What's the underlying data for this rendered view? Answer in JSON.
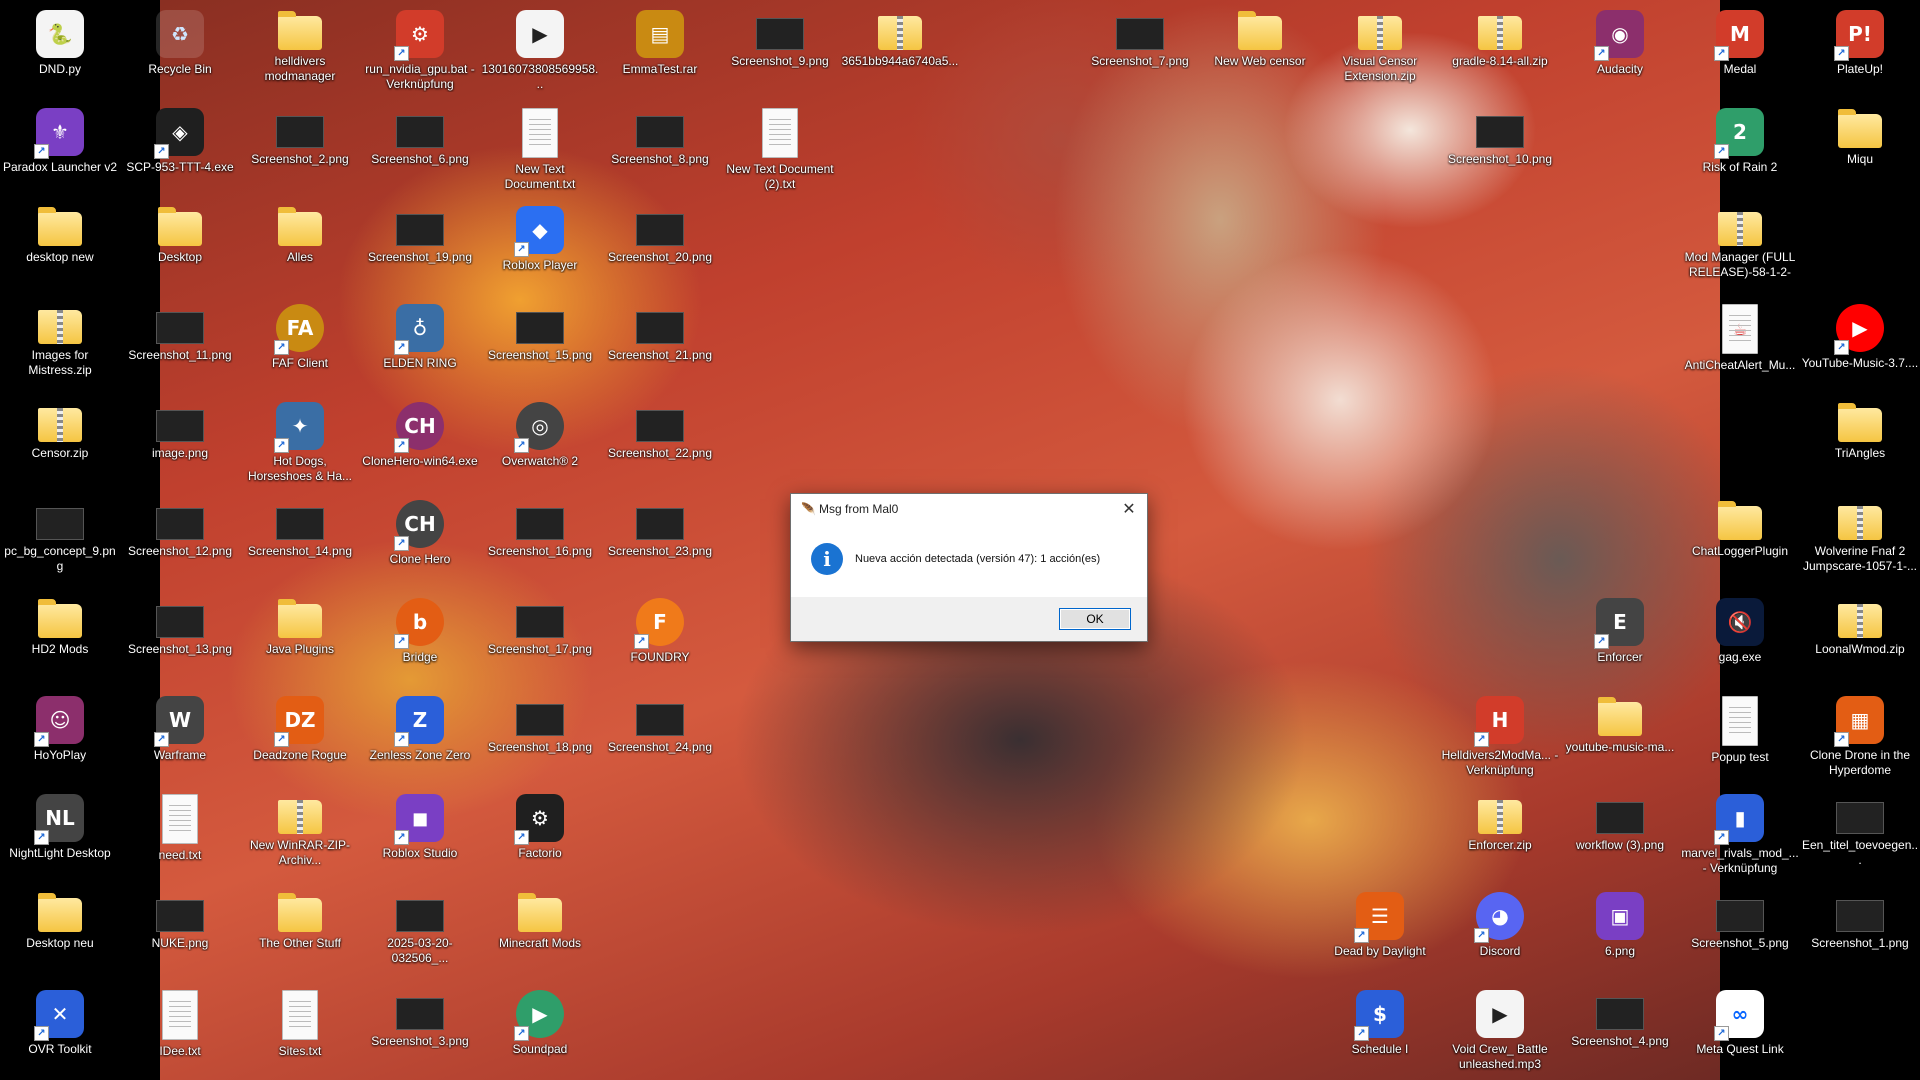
{
  "desktop": {
    "icons": [
      {
        "label": "DND.py",
        "kind": "python",
        "icon": "python-file-icon",
        "col": 0,
        "row": 0
      },
      {
        "label": "Paradox Launcher v2",
        "kind": "app",
        "icon": "paradox-launcher-icon",
        "col": 0,
        "row": 1
      },
      {
        "label": "desktop new",
        "kind": "folder",
        "icon": "folder-icon",
        "col": 0,
        "row": 2
      },
      {
        "label": "Images for Mistress.zip",
        "kind": "zip",
        "icon": "zip-folder-icon",
        "col": 0,
        "row": 3
      },
      {
        "label": "Censor.zip",
        "kind": "zip",
        "icon": "zip-folder-icon",
        "col": 0,
        "row": 4
      },
      {
        "label": "pc_bg_concept_9.png",
        "kind": "shot",
        "icon": "image-file-icon",
        "col": 0,
        "row": 5
      },
      {
        "label": "HD2 Mods",
        "kind": "folder",
        "icon": "folder-icon",
        "col": 0,
        "row": 6
      },
      {
        "label": "HoYoPlay",
        "kind": "app",
        "icon": "hoyoplay-icon",
        "col": 0,
        "row": 7
      },
      {
        "label": "NightLight Desktop",
        "kind": "app",
        "icon": "nightlight-icon",
        "col": 0,
        "row": 8
      },
      {
        "label": "Desktop neu",
        "kind": "folder",
        "icon": "folder-icon",
        "col": 0,
        "row": 9
      },
      {
        "label": "OVR Toolkit",
        "kind": "app",
        "icon": "ovr-toolkit-icon",
        "col": 0,
        "row": 10
      },
      {
        "label": "Recycle Bin",
        "kind": "bin",
        "icon": "recycle-bin-icon",
        "col": 1,
        "row": 0
      },
      {
        "label": "SCP-953-TTT-4.exe",
        "kind": "app",
        "icon": "exe-icon",
        "col": 1,
        "row": 1
      },
      {
        "label": "Desktop",
        "kind": "folder",
        "icon": "folder-icon",
        "col": 1,
        "row": 2
      },
      {
        "label": "Screenshot_11.png",
        "kind": "shot",
        "icon": "image-file-icon",
        "col": 1,
        "row": 3
      },
      {
        "label": "image.png",
        "kind": "shot",
        "icon": "image-file-icon",
        "col": 1,
        "row": 4
      },
      {
        "label": "Screenshot_12.png",
        "kind": "shot",
        "icon": "image-file-icon",
        "col": 1,
        "row": 5
      },
      {
        "label": "Screenshot_13.png",
        "kind": "shot",
        "icon": "image-file-icon",
        "col": 1,
        "row": 6
      },
      {
        "label": "Warframe",
        "kind": "app",
        "icon": "warframe-icon",
        "col": 1,
        "row": 7
      },
      {
        "label": "need.txt",
        "kind": "doc",
        "icon": "text-file-icon",
        "col": 1,
        "row": 8
      },
      {
        "label": "NUKE.png",
        "kind": "shot",
        "icon": "image-file-icon",
        "col": 1,
        "row": 9
      },
      {
        "label": "IDee.txt",
        "kind": "doc",
        "icon": "text-file-icon",
        "col": 1,
        "row": 10
      },
      {
        "label": "helldivers modmanager",
        "kind": "folder",
        "icon": "folder-icon",
        "col": 2,
        "row": 0
      },
      {
        "label": "Screenshot_2.png",
        "kind": "shot",
        "icon": "image-file-icon",
        "col": 2,
        "row": 1
      },
      {
        "label": "Alles",
        "kind": "folder",
        "icon": "folder-icon",
        "col": 2,
        "row": 2
      },
      {
        "label": "FAF Client",
        "kind": "app",
        "icon": "faf-client-icon",
        "col": 2,
        "row": 3
      },
      {
        "label": "Hot Dogs, Horseshoes & Ha...",
        "kind": "app",
        "icon": "hot-dogs-icon",
        "col": 2,
        "row": 4
      },
      {
        "label": "Screenshot_14.png",
        "kind": "shot",
        "icon": "image-file-icon",
        "col": 2,
        "row": 5
      },
      {
        "label": "Java Plugins",
        "kind": "folder",
        "icon": "folder-icon",
        "col": 2,
        "row": 6
      },
      {
        "label": "Deadzone Rogue",
        "kind": "app",
        "icon": "deadzone-rogue-icon",
        "col": 2,
        "row": 7
      },
      {
        "label": "New WinRAR-ZIP-Archiv...",
        "kind": "zip",
        "icon": "zip-folder-icon",
        "col": 2,
        "row": 8
      },
      {
        "label": "The Other Stuff",
        "kind": "folder",
        "icon": "folder-icon",
        "col": 2,
        "row": 9
      },
      {
        "label": "Sites.txt",
        "kind": "doc",
        "icon": "text-file-icon",
        "col": 2,
        "row": 10
      },
      {
        "label": "run_nvidia_gpu.bat - Verknüpfung",
        "kind": "bat",
        "icon": "batch-file-icon",
        "col": 3,
        "row": 0
      },
      {
        "label": "Screenshot_6.png",
        "kind": "shot",
        "icon": "image-file-icon",
        "col": 3,
        "row": 1
      },
      {
        "label": "Screenshot_19.png",
        "kind": "shot",
        "icon": "image-file-icon",
        "col": 3,
        "row": 2
      },
      {
        "label": "ELDEN RING",
        "kind": "app",
        "icon": "elden-ring-icon",
        "col": 3,
        "row": 3
      },
      {
        "label": "CloneHero-win64.exe",
        "kind": "app",
        "icon": "clone-hero-installer-icon",
        "col": 3,
        "row": 4
      },
      {
        "label": "Clone Hero",
        "kind": "app",
        "icon": "clone-hero-icon",
        "col": 3,
        "row": 5
      },
      {
        "label": "Bridge",
        "kind": "app",
        "icon": "bridge-icon",
        "col": 3,
        "row": 6
      },
      {
        "label": "Zenless Zone Zero",
        "kind": "app",
        "icon": "zenless-zone-zero-icon",
        "col": 3,
        "row": 7
      },
      {
        "label": "Roblox Studio",
        "kind": "app",
        "icon": "roblox-studio-icon",
        "col": 3,
        "row": 8
      },
      {
        "label": "2025-03-20-032506_...",
        "kind": "shot",
        "icon": "image-file-icon",
        "col": 3,
        "row": 9
      },
      {
        "label": "Screenshot_3.png",
        "kind": "shot",
        "icon": "image-file-icon",
        "col": 3,
        "row": 10
      },
      {
        "label": "13016073808569958...",
        "kind": "media",
        "icon": "media-file-icon",
        "col": 4,
        "row": 0
      },
      {
        "label": "New Text Document.txt",
        "kind": "doc",
        "icon": "text-file-icon",
        "col": 4,
        "row": 1
      },
      {
        "label": "Roblox Player",
        "kind": "app",
        "icon": "roblox-player-icon",
        "col": 4,
        "row": 2
      },
      {
        "label": "Screenshot_15.png",
        "kind": "shot",
        "icon": "image-file-icon",
        "col": 4,
        "row": 3
      },
      {
        "label": "Overwatch® 2",
        "kind": "app",
        "icon": "overwatch-icon",
        "col": 4,
        "row": 4
      },
      {
        "label": "Screenshot_16.png",
        "kind": "shot",
        "icon": "image-file-icon",
        "col": 4,
        "row": 5
      },
      {
        "label": "Screenshot_17.png",
        "kind": "shot",
        "icon": "image-file-icon",
        "col": 4,
        "row": 6
      },
      {
        "label": "Screenshot_18.png",
        "kind": "shot",
        "icon": "image-file-icon",
        "col": 4,
        "row": 7
      },
      {
        "label": "Factorio",
        "kind": "app",
        "icon": "factorio-icon",
        "col": 4,
        "row": 8
      },
      {
        "label": "Minecraft Mods",
        "kind": "folder",
        "icon": "folder-icon",
        "col": 4,
        "row": 9
      },
      {
        "label": "Soundpad",
        "kind": "app",
        "icon": "soundpad-icon",
        "col": 4,
        "row": 10
      },
      {
        "label": "EmmaTest.rar",
        "kind": "rar",
        "icon": "winrar-archive-icon",
        "col": 5,
        "row": 0
      },
      {
        "label": "Screenshot_8.png",
        "kind": "shot",
        "icon": "image-file-icon",
        "col": 5,
        "row": 1
      },
      {
        "label": "Screenshot_20.png",
        "kind": "shot",
        "icon": "image-file-icon",
        "col": 5,
        "row": 2
      },
      {
        "label": "Screenshot_21.png",
        "kind": "shot",
        "icon": "image-file-icon",
        "col": 5,
        "row": 3
      },
      {
        "label": "Screenshot_22.png",
        "kind": "shot",
        "icon": "image-file-icon",
        "col": 5,
        "row": 4
      },
      {
        "label": "Screenshot_23.png",
        "kind": "shot",
        "icon": "image-file-icon",
        "col": 5,
        "row": 5
      },
      {
        "label": "FOUNDRY",
        "kind": "app",
        "icon": "foundry-icon",
        "col": 5,
        "row": 6
      },
      {
        "label": "Screenshot_24.png",
        "kind": "shot",
        "icon": "image-file-icon",
        "col": 5,
        "row": 7
      },
      {
        "label": "Screenshot_9.png",
        "kind": "shot",
        "icon": "image-file-icon",
        "col": 6,
        "row": 0
      },
      {
        "label": "New Text Document (2).txt",
        "kind": "doc",
        "icon": "text-file-icon",
        "col": 6,
        "row": 1
      },
      {
        "label": "3651bb944a6740a5...",
        "kind": "zip",
        "icon": "zip-folder-icon",
        "col": 7,
        "row": 0
      },
      {
        "label": "Screenshot_7.png",
        "kind": "shot",
        "icon": "image-file-icon",
        "col": 9,
        "row": 0
      },
      {
        "label": "New Web censor",
        "kind": "folder",
        "icon": "folder-icon",
        "col": 10,
        "row": 0
      },
      {
        "label": "Visual Censor Extension.zip",
        "kind": "zip",
        "icon": "zip-folder-icon",
        "col": 11,
        "row": 0
      },
      {
        "label": "Dead by Daylight",
        "kind": "app",
        "icon": "dead-by-daylight-icon",
        "col": 11,
        "row": 9
      },
      {
        "label": "Schedule I",
        "kind": "app",
        "icon": "schedule-one-icon",
        "col": 11,
        "row": 10
      },
      {
        "label": "gradle-8.14-all.zip",
        "kind": "zip",
        "icon": "zip-folder-icon",
        "col": 12,
        "row": 0
      },
      {
        "label": "Screenshot_10.png",
        "kind": "shot",
        "icon": "image-file-icon",
        "col": 12,
        "row": 1
      },
      {
        "label": "Helldivers2ModMa... - Verknüpfung",
        "kind": "app",
        "icon": "helldivers-mod-manager-icon",
        "col": 12,
        "row": 7
      },
      {
        "label": "Enforcer.zip",
        "kind": "zip",
        "icon": "zip-folder-icon",
        "col": 12,
        "row": 8
      },
      {
        "label": "Discord",
        "kind": "app",
        "icon": "discord-icon",
        "col": 12,
        "row": 9
      },
      {
        "label": "Void Crew_ Battle unleashed.mp3",
        "kind": "media",
        "icon": "media-file-icon",
        "col": 12,
        "row": 10
      },
      {
        "label": "Audacity",
        "kind": "app",
        "icon": "audacity-icon",
        "col": 13,
        "row": 0
      },
      {
        "label": "Enforcer",
        "kind": "app",
        "icon": "enforcer-icon",
        "col": 13,
        "row": 6
      },
      {
        "label": "youtube-music-ma...",
        "kind": "folder",
        "icon": "folder-icon",
        "col": 13,
        "row": 7
      },
      {
        "label": "workflow (3).png",
        "kind": "shot",
        "icon": "image-file-icon",
        "col": 13,
        "row": 8
      },
      {
        "label": "6.png",
        "kind": "app",
        "icon": "image-file-icon",
        "col": 13,
        "row": 9
      },
      {
        "label": "Screenshot_4.png",
        "kind": "shot",
        "icon": "image-file-icon",
        "col": 13,
        "row": 10
      },
      {
        "label": "Medal",
        "kind": "app",
        "icon": "medal-icon",
        "col": 14,
        "row": 0
      },
      {
        "label": "Risk of Rain 2",
        "kind": "app",
        "icon": "risk-of-rain-2-icon",
        "col": 14,
        "row": 1
      },
      {
        "label": "Mod Manager (FULL RELEASE)-58-1-2-0-...",
        "kind": "zip",
        "icon": "zip-folder-icon",
        "col": 14,
        "row": 2
      },
      {
        "label": "AntiCheatAlert_Mu...",
        "kind": "java",
        "icon": "java-file-icon",
        "col": 14,
        "row": 3
      },
      {
        "label": "ChatLoggerPlugin",
        "kind": "folder",
        "icon": "folder-icon",
        "col": 14,
        "row": 5
      },
      {
        "label": "gag.exe",
        "kind": "app",
        "icon": "mute-speaker-icon",
        "col": 14,
        "row": 6
      },
      {
        "label": "Popup test",
        "kind": "blank",
        "icon": "blank-file-icon",
        "col": 14,
        "row": 7
      },
      {
        "label": "marvel_rivals_mod_... - Verknüpfung",
        "kind": "app",
        "icon": "marvel-rivals-mod-icon",
        "col": 14,
        "row": 8
      },
      {
        "label": "Screenshot_5.png",
        "kind": "shot",
        "icon": "image-file-icon",
        "col": 14,
        "row": 9
      },
      {
        "label": "Meta Quest Link",
        "kind": "app",
        "icon": "meta-quest-icon",
        "col": 14,
        "row": 10
      },
      {
        "label": "PlateUp!",
        "kind": "app",
        "icon": "plateup-icon",
        "col": 15,
        "row": 0
      },
      {
        "label": "Miqu",
        "kind": "folder",
        "icon": "folder-icon",
        "col": 15,
        "row": 1
      },
      {
        "label": "YouTube-Music-3.7....",
        "kind": "app",
        "icon": "youtube-music-icon",
        "col": 15,
        "row": 3
      },
      {
        "label": "TriAngles",
        "kind": "folder",
        "icon": "folder-icon",
        "col": 15,
        "row": 4
      },
      {
        "label": "Wolverine Fnaf 2 Jumpscare-1057-1-...",
        "kind": "zip",
        "icon": "zip-folder-icon",
        "col": 15,
        "row": 5
      },
      {
        "label": "LoonalWmod.zip",
        "kind": "zip",
        "icon": "zip-folder-icon",
        "col": 15,
        "row": 6
      },
      {
        "label": "Clone Drone in the Hyperdome",
        "kind": "app",
        "icon": "clone-drone-icon",
        "col": 15,
        "row": 7
      },
      {
        "label": "Een_titel_toevoegen...",
        "kind": "shot",
        "icon": "image-file-icon",
        "col": 15,
        "row": 8
      },
      {
        "label": "Screenshot_1.png",
        "kind": "shot",
        "icon": "image-file-icon",
        "col": 15,
        "row": 9
      }
    ]
  },
  "dialog": {
    "title": "Msg from Mal0",
    "message": "Nueva acción detectada (versión 47): 1 acción(es)",
    "ok_label": "OK",
    "close_glyph": "✕",
    "info_glyph": "i",
    "title_glyph": "🪶"
  },
  "colors": {
    "info_blue": "#1a73d2",
    "ok_border": "#0066cc",
    "folder_yellow": "#f5c542"
  }
}
